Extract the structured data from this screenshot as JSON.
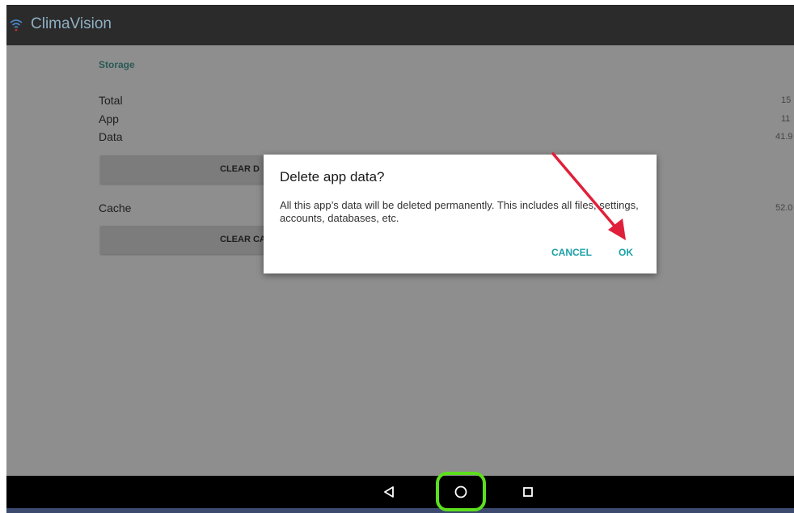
{
  "app": {
    "title": "ClimaVision",
    "icon": "wifi-signal-icon"
  },
  "storage": {
    "section_title": "Storage",
    "rows": [
      {
        "label": "Total",
        "value": "15"
      },
      {
        "label": "App",
        "value": "11"
      },
      {
        "label": "Data",
        "value": "41.9"
      }
    ],
    "clear_data_label": "CLEAR D",
    "cache_label": "Cache",
    "cache_value": "52.0",
    "clear_cache_label": "CLEAR CA"
  },
  "dialog": {
    "title": "Delete app data?",
    "message": "All this app’s data will be deleted permanently. This includes all files, settings, accounts, databases, etc.",
    "cancel_label": "CANCEL",
    "ok_label": "OK"
  },
  "navbar": {
    "back_icon": "back-triangle-icon",
    "home_icon": "home-circle-icon",
    "recents_icon": "recents-square-icon"
  },
  "colors": {
    "accent": "#1ba1a8",
    "annotation_arrow": "#e0203a",
    "annotation_highlight": "#5ddf1c",
    "appbar": "#2b2b2b"
  }
}
